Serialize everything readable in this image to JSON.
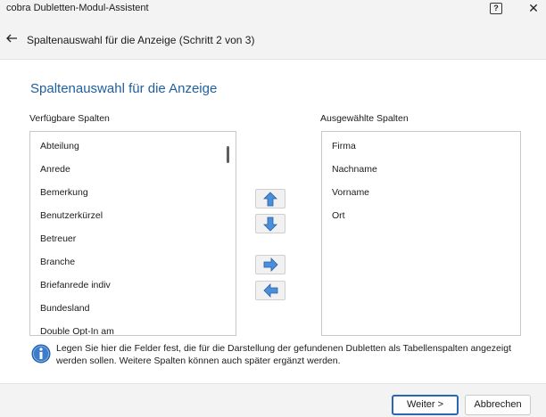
{
  "window": {
    "title": "cobra Dubletten-Modul-Assistent",
    "help_label": "?",
    "close_label": "✕"
  },
  "header": {
    "step_title": "Spaltenauswahl für die Anzeige (Schritt 2 von 3)"
  },
  "main": {
    "heading": "Spaltenauswahl für die Anzeige",
    "available_label": "Verfügbare Spalten",
    "selected_label": "Ausgewählte Spalten",
    "available_items": [
      "Abteilung",
      "Anrede",
      "Bemerkung",
      "Benutzerkürzel",
      "Betreuer",
      "Branche",
      "Briefanrede indiv",
      "Bundesland",
      "Double Opt-In am"
    ],
    "selected_items": [
      "Firma",
      "Nachname",
      "Vorname",
      "Ort"
    ],
    "info_text": "Legen Sie hier die Felder fest, die für die Darstellung der gefundenen Dubletten als Tabellenspalten angezeigt werden sollen. Weitere Spalten können auch später ergänzt werden."
  },
  "footer": {
    "next_label": "Weiter >",
    "cancel_label": "Abbrechen"
  },
  "icons": {
    "back": "back-arrow-icon",
    "move_up": "arrow-up-icon",
    "move_down": "arrow-down-icon",
    "add": "arrow-right-icon",
    "remove": "arrow-left-icon",
    "info": "info-icon"
  },
  "colors": {
    "heading": "#1f5f9e",
    "accent": "#2b66b5",
    "arrow_fill": "#4a8fdc"
  }
}
